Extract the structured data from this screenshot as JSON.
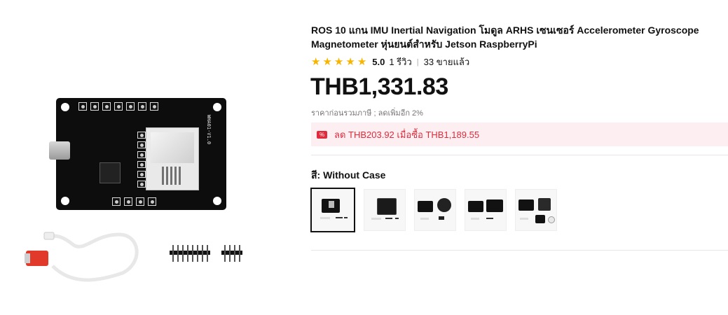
{
  "product": {
    "title": "ROS 10 แกน IMU Inertial Navigation โมดูล ARHS เซนเซอร์ Accelerometer Gyroscope Magnetometer หุ่นยนต์สำหรับ Jetson RaspberryPi",
    "rating": {
      "stars": 5,
      "score": "5.0",
      "reviews": "1 รีวิว",
      "sold": "33 ขายแล้ว"
    },
    "price": "THB1,331.83",
    "tax_note": "ราคาก่อนรวมภาษี ; ลดเพิ่มอีก 2%",
    "promo": {
      "icon": "discount-tag-icon",
      "text": "ลด THB203.92 เมื่อซื้อ THB1,189.55"
    },
    "variant": {
      "label": "สี: Without Case",
      "selected_index": 0,
      "options_count": 5
    }
  },
  "main_image": {
    "board_label": "WHA01-V1.0"
  },
  "colors": {
    "accent_red": "#e02b3c",
    "promo_bg": "#fdeff1",
    "star": "#f7b500"
  }
}
